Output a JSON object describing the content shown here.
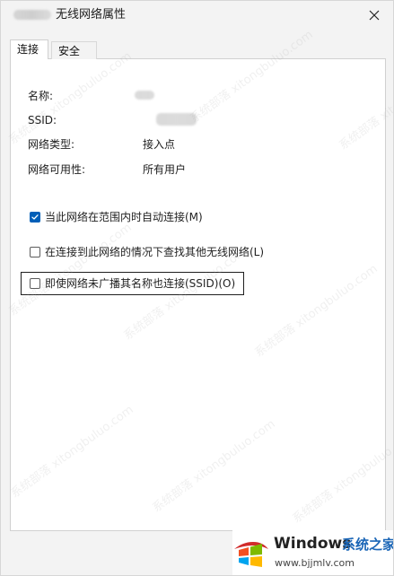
{
  "window": {
    "title": "无线网络属性"
  },
  "tabs": [
    {
      "label": "连接"
    },
    {
      "label": "安全"
    }
  ],
  "details": {
    "name_label": "名称:",
    "ssid_label": "SSID:",
    "network_type_label": "网络类型:",
    "network_type_value": "接入点",
    "availability_label": "网络可用性:",
    "availability_value": "所有用户"
  },
  "options": [
    {
      "label": "当此网络在范围内时自动连接(M)",
      "checked": true
    },
    {
      "label": "在连接到此网络的情况下查找其他无线网络(L)",
      "checked": false
    },
    {
      "label": "即使网络未广播其名称也连接(SSID)(O)",
      "checked": false
    }
  ],
  "watermark": {
    "text": "系统部落 xitongbuluo.com"
  },
  "branding": {
    "windows": "Windows",
    "cn": "系统之家",
    "url": "www.bjjmlv.com"
  },
  "colors": {
    "accent": "#005fb8",
    "brand_blue": "#1b66b7"
  },
  "icons": {
    "close": "close-icon",
    "check": "checkmark-icon",
    "logo": "windows-logo-icon"
  }
}
